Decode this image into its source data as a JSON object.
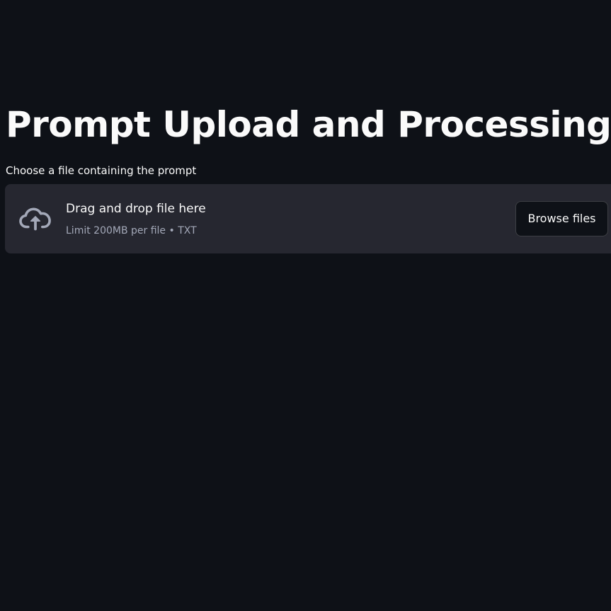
{
  "page": {
    "title": "Prompt Upload and Processing"
  },
  "uploader": {
    "label": "Choose a file containing the prompt",
    "drop_title": "Drag and drop file here",
    "limit_text": "Limit 200MB per file • TXT",
    "browse_label": "Browse files",
    "icon": "cloud-upload-icon"
  },
  "colors": {
    "background": "#0e1117",
    "dropzone": "#262730",
    "text": "#fafafa",
    "muted_text": "#a3a8b8",
    "icon": "#a3a8b8"
  }
}
